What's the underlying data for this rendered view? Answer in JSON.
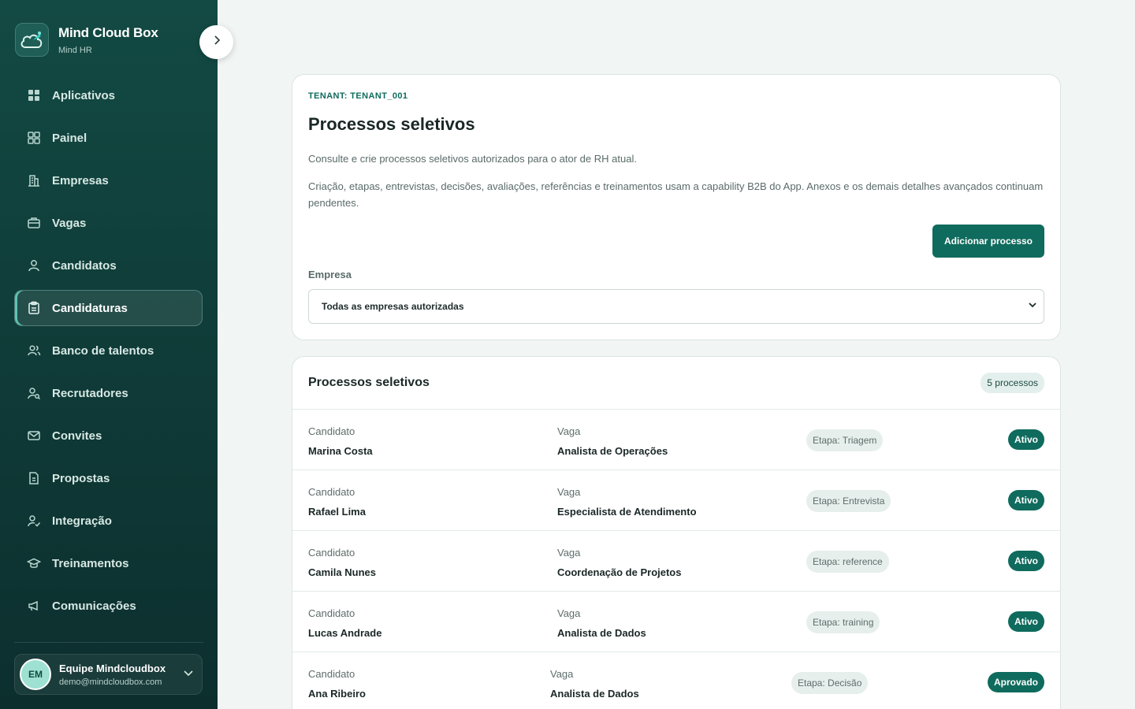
{
  "brand": {
    "title": "Mind Cloud Box",
    "subtitle": "Mind HR",
    "logo_icon": "cloud-rocket-icon"
  },
  "sidebar": {
    "items": [
      {
        "label": "Aplicativos",
        "icon": "apps-grid-icon"
      },
      {
        "label": "Painel",
        "icon": "dashboard-icon"
      },
      {
        "label": "Empresas",
        "icon": "building-icon"
      },
      {
        "label": "Vagas",
        "icon": "briefcase-icon"
      },
      {
        "label": "Candidatos",
        "icon": "user-icon"
      },
      {
        "label": "Candidaturas",
        "icon": "clipboard-icon",
        "active": true
      },
      {
        "label": "Banco de talentos",
        "icon": "users-icon"
      },
      {
        "label": "Recrutadores",
        "icon": "user-search-icon"
      },
      {
        "label": "Convites",
        "icon": "mail-icon"
      },
      {
        "label": "Propostas",
        "icon": "document-icon"
      },
      {
        "label": "Integração",
        "icon": "user-check-icon"
      },
      {
        "label": "Treinamentos",
        "icon": "graduation-cap-icon"
      },
      {
        "label": "Comunicações",
        "icon": "megaphone-icon"
      }
    ]
  },
  "user": {
    "initials": "EM",
    "name": "Equipe Mindcloudbox",
    "email": "demo@mindcloudbox.com"
  },
  "header": {
    "tenant": "TENANT: TENANT_001",
    "title": "Processos seletivos",
    "description": "Consulte e crie processos seletivos autorizados para o ator de RH atual.",
    "note": "Criação, etapas, entrevistas, decisões, avaliações, referências e treinamentos usam a capability B2B do App. Anexos e os demais detalhes avançados continuam pendentes.",
    "add_button": "Adicionar processo",
    "company_label": "Empresa",
    "company_selected": "Todas as empresas autorizadas"
  },
  "list": {
    "title": "Processos seletivos",
    "count": "5 processos",
    "candidate_label": "Candidato",
    "job_label": "Vaga",
    "rows": [
      {
        "candidate": "Marina Costa",
        "job": "Analista de Operações",
        "stage": "Etapa: Triagem",
        "status": "Ativo"
      },
      {
        "candidate": "Rafael Lima",
        "job": "Especialista de Atendimento",
        "stage": "Etapa: Entrevista",
        "status": "Ativo"
      },
      {
        "candidate": "Camila Nunes",
        "job": "Coordenação de Projetos",
        "stage": "Etapa: reference",
        "status": "Ativo"
      },
      {
        "candidate": "Lucas Andrade",
        "job": "Analista de Dados",
        "stage": "Etapa: training",
        "status": "Ativo"
      },
      {
        "candidate": "Ana Ribeiro",
        "job": "Analista de Dados",
        "stage": "Etapa: Decisão",
        "status": "Aprovado"
      }
    ]
  },
  "colors": {
    "primary": "#0f6b5d",
    "sidebar_bg": "#0f3a37",
    "page_bg": "#f1f5f4"
  }
}
